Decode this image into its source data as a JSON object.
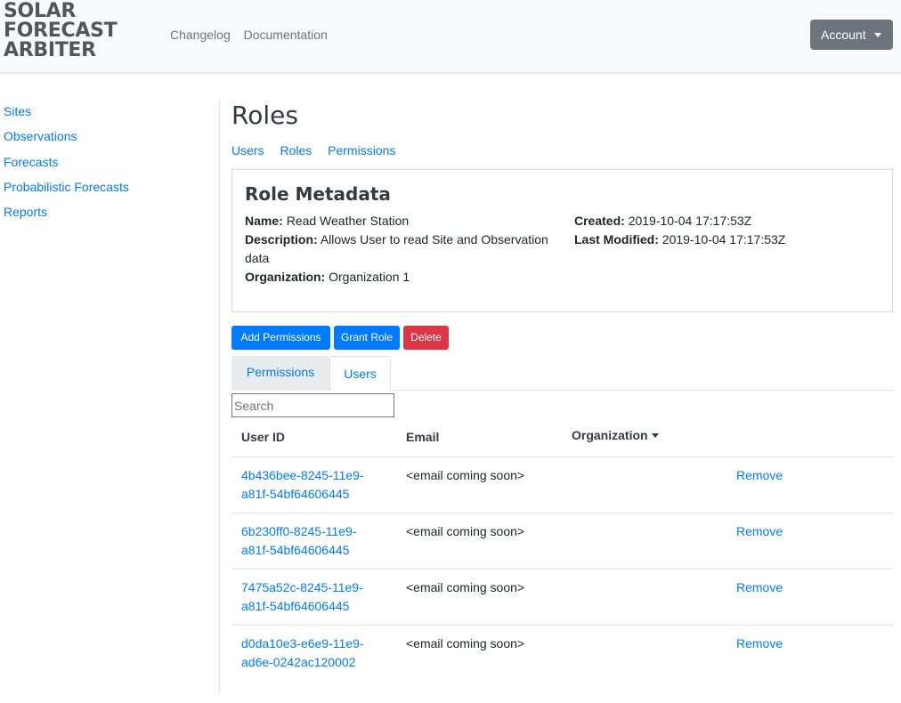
{
  "brand": {
    "line1": "SOLAR",
    "line2": "FORECAST",
    "line3": "ARBITER"
  },
  "topnav": {
    "changelog": "Changelog",
    "documentation": "Documentation"
  },
  "account": {
    "label": "Account"
  },
  "sidebar": {
    "items": [
      {
        "label": "Sites"
      },
      {
        "label": "Observations"
      },
      {
        "label": "Forecasts"
      },
      {
        "label": "Probabilistic Forecasts"
      },
      {
        "label": "Reports"
      }
    ]
  },
  "page": {
    "title": "Roles"
  },
  "subnav": {
    "users": "Users",
    "roles": "Roles",
    "permissions": "Permissions"
  },
  "metadata": {
    "title": "Role Metadata",
    "name_label": "Name:",
    "name_value": "Read Weather Station",
    "description_label": "Description:",
    "description_value": "Allows User to read Site and Observation data",
    "organization_label": "Organization:",
    "organization_value": "Organization 1",
    "created_label": "Created:",
    "created_value": "2019-10-04 17:17:53Z",
    "modified_label": "Last Modified:",
    "modified_value": "2019-10-04 17:17:53Z"
  },
  "actions": {
    "add_permissions": "Add Permissions",
    "grant_role": "Grant Role",
    "delete": "Delete"
  },
  "tabs": {
    "permissions": "Permissions",
    "users": "Users"
  },
  "search": {
    "placeholder": "Search"
  },
  "table": {
    "headers": {
      "user_id": "User ID",
      "email": "Email",
      "organization": "Organization"
    },
    "rows": [
      {
        "id_line1": "4b436bee-8245-11e9-",
        "id_line2": "a81f-54bf64606445",
        "email": "<email coming soon>",
        "action": "Remove"
      },
      {
        "id_line1": "6b230ff0-8245-11e9-",
        "id_line2": "a81f-54bf64606445",
        "email": "<email coming soon>",
        "action": "Remove"
      },
      {
        "id_line1": "7475a52c-8245-11e9-",
        "id_line2": "a81f-54bf64606445",
        "email": "<email coming soon>",
        "action": "Remove"
      },
      {
        "id_line1": "d0da10e3-e6e9-11e9-",
        "id_line2": "ad6e-0242ac120002",
        "email": "<email coming soon>",
        "action": "Remove"
      }
    ]
  },
  "colors": {
    "link": "#007bff",
    "danger": "#dc3545",
    "secondary": "#6c757d",
    "header_bg": "#f8f9fa"
  }
}
